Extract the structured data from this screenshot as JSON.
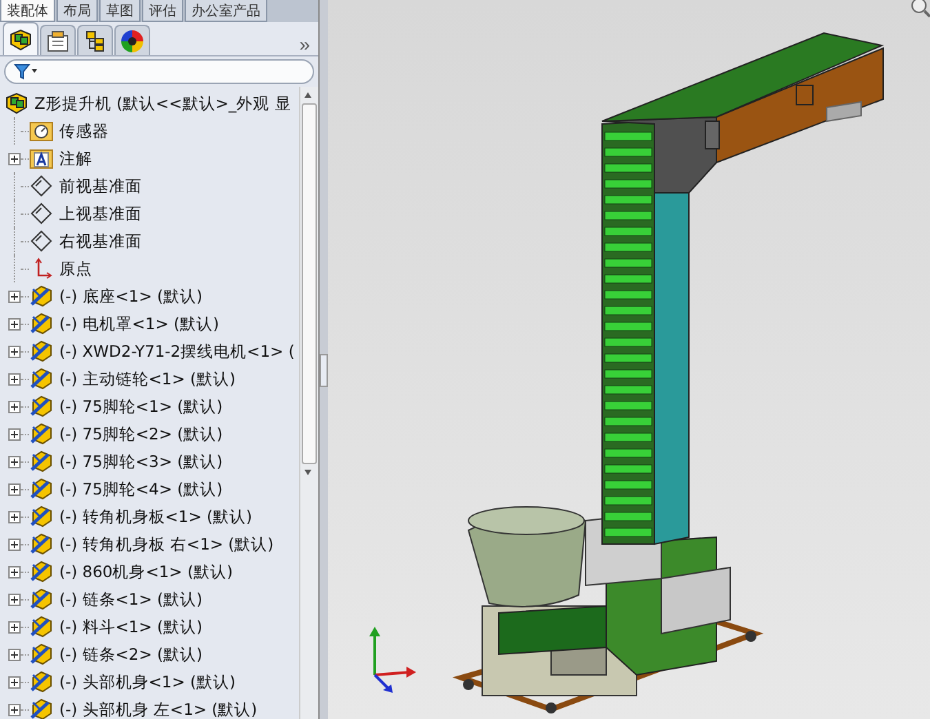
{
  "top_tabs": [
    {
      "label": "装配体",
      "selected": true
    },
    {
      "label": "布局",
      "selected": false
    },
    {
      "label": "草图",
      "selected": false
    },
    {
      "label": "评估",
      "selected": false
    },
    {
      "label": "办公室产品",
      "selected": false
    }
  ],
  "panel_tabs": [
    {
      "kind": "tree",
      "selected": true
    },
    {
      "kind": "property",
      "selected": false
    },
    {
      "kind": "config",
      "selected": false
    },
    {
      "kind": "appearance",
      "selected": false
    }
  ],
  "panel_more": "»",
  "tree": {
    "root": "Z形提升机  (默认<<默认>_外观 显",
    "items": [
      {
        "kind": "sensor",
        "label": "传感器"
      },
      {
        "kind": "annotation",
        "label": "注解"
      },
      {
        "kind": "plane",
        "label": "前视基准面"
      },
      {
        "kind": "plane",
        "label": "上视基准面"
      },
      {
        "kind": "plane",
        "label": "右视基准面"
      },
      {
        "kind": "origin",
        "label": "原点"
      },
      {
        "kind": "part",
        "label": "(-) 底座<1> (默认)"
      },
      {
        "kind": "part",
        "label": "(-) 电机罩<1> (默认)"
      },
      {
        "kind": "part",
        "label": "(-) XWD2-Y71-2摆线电机<1> ("
      },
      {
        "kind": "part",
        "label": "(-) 主动链轮<1> (默认)"
      },
      {
        "kind": "part",
        "label": "(-) 75脚轮<1> (默认)"
      },
      {
        "kind": "part",
        "label": "(-) 75脚轮<2> (默认)"
      },
      {
        "kind": "part",
        "label": "(-) 75脚轮<3> (默认)"
      },
      {
        "kind": "part",
        "label": "(-) 75脚轮<4> (默认)"
      },
      {
        "kind": "part",
        "label": "(-) 转角机身板<1> (默认)"
      },
      {
        "kind": "part",
        "label": "(-) 转角机身板 右<1> (默认)"
      },
      {
        "kind": "part",
        "label": "(-) 860机身<1> (默认)"
      },
      {
        "kind": "part",
        "label": "(-) 链条<1> (默认)"
      },
      {
        "kind": "part",
        "label": "(-) 料斗<1> (默认)"
      },
      {
        "kind": "part",
        "label": "(-) 链条<2> (默认)"
      },
      {
        "kind": "part",
        "label": "(-) 头部机身<1> (默认)"
      },
      {
        "kind": "part",
        "label": "(-) 头部机身 左<1> (默认)"
      }
    ]
  }
}
